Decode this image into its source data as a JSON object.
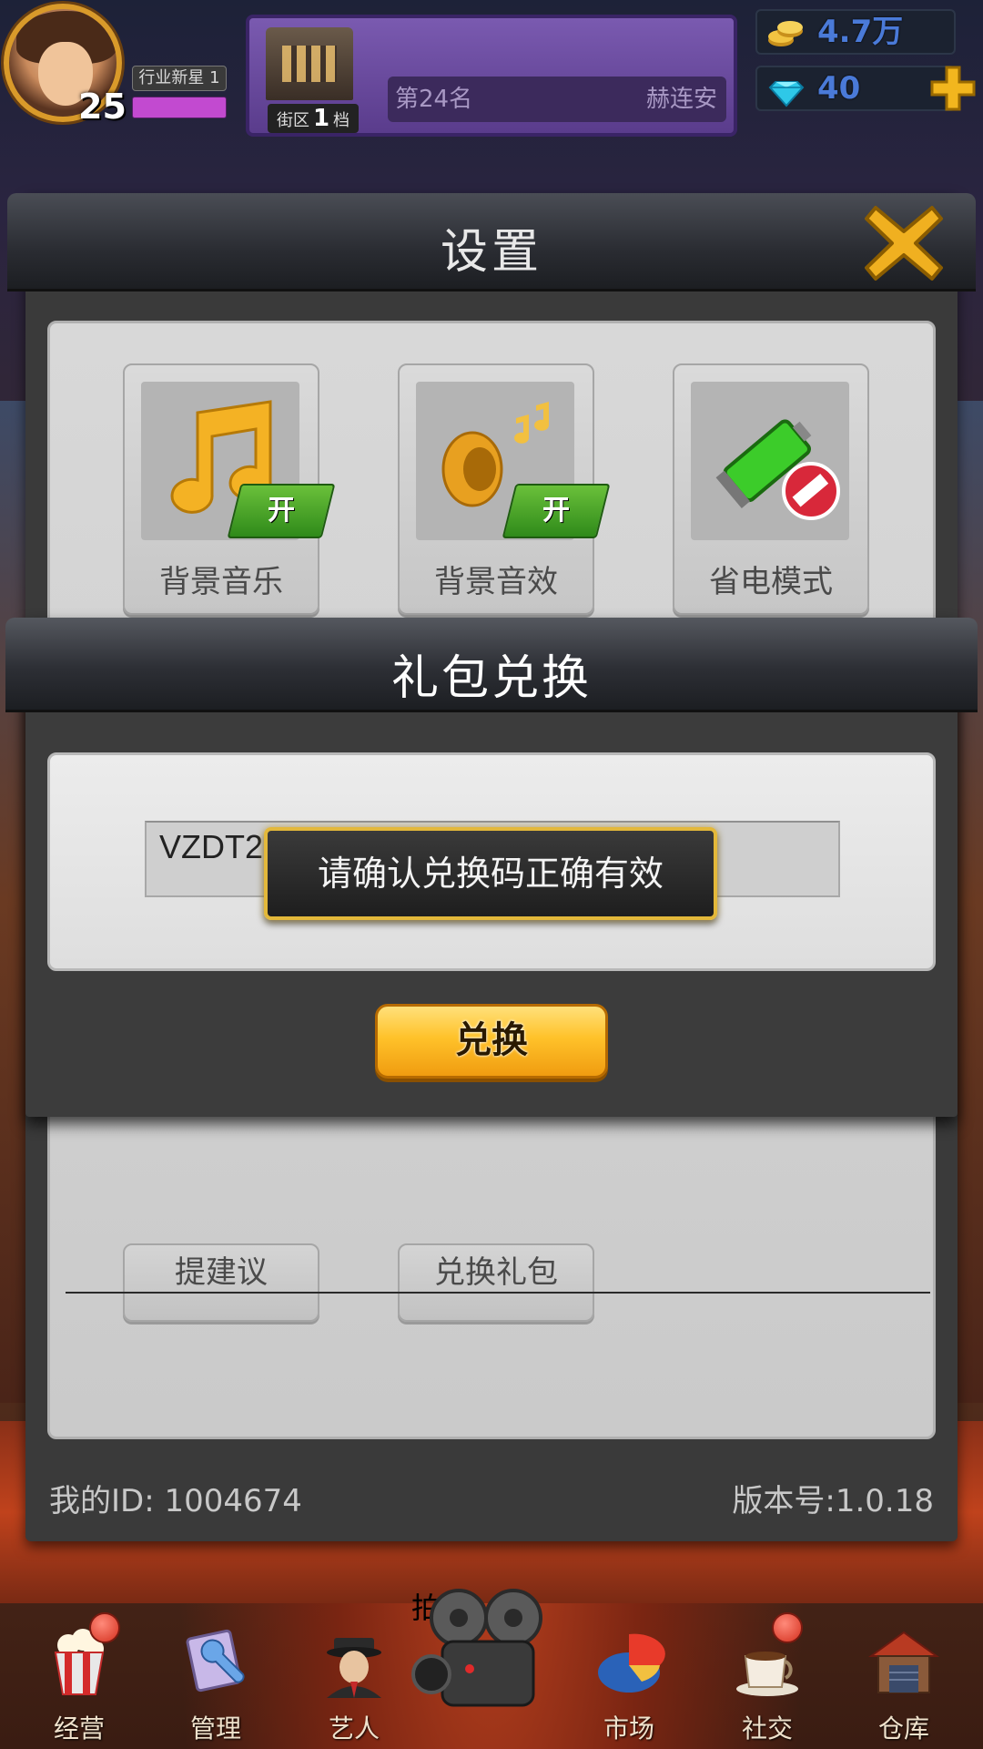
{
  "hud": {
    "level": "25",
    "rank_title": "行业新星 1",
    "district": {
      "prefix": "街区",
      "number": "1",
      "suffix": "档"
    },
    "ranking": "第24名",
    "player_name": "赫连安",
    "gold": "4.7万",
    "gems": "40"
  },
  "settings": {
    "title": "设置",
    "tiles": [
      {
        "label": "背景音乐",
        "state": "开",
        "icon": "music-note-icon"
      },
      {
        "label": "背景音效",
        "state": "开",
        "icon": "speaker-icon"
      },
      {
        "label": "省电模式",
        "state": "off",
        "icon": "battery-saver-icon"
      }
    ],
    "buttons": {
      "feedback": "提建议",
      "redeem": "兑换礼包"
    },
    "footer": {
      "my_id": "我的ID: 1004674",
      "version": "版本号:1.0.18"
    }
  },
  "gift_dialog": {
    "title": "礼包兑换",
    "code_value": "VZDT2",
    "toast": "请确认兑换码正确有效",
    "exchange_label": "兑换"
  },
  "bottom_nav": [
    {
      "label": "经营",
      "icon": "popcorn-icon",
      "badge": true
    },
    {
      "label": "管理",
      "icon": "wrench-icon",
      "badge": false
    },
    {
      "label": "艺人",
      "icon": "agent-icon",
      "badge": false
    },
    {
      "label": "拍摄",
      "icon": "film-camera-icon",
      "badge": false
    },
    {
      "label": "市场",
      "icon": "pie-chart-icon",
      "badge": false
    },
    {
      "label": "社交",
      "icon": "coffee-cup-icon",
      "badge": true
    },
    {
      "label": "仓库",
      "icon": "warehouse-icon",
      "badge": false
    }
  ],
  "colors": {
    "accent_gold": "#e3b83a",
    "toggle_green": "#3fa023",
    "exchange_orange": "#ffc22a",
    "panel_gray": "#d8d8d8"
  }
}
